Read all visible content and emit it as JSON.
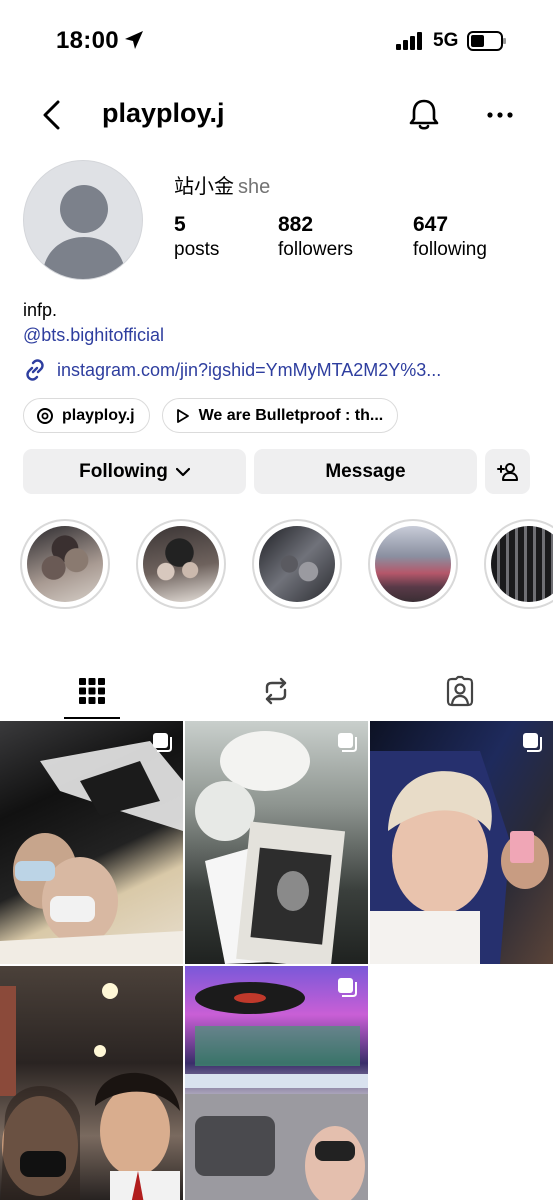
{
  "status_bar": {
    "time": "18:00",
    "network": "5G"
  },
  "header": {
    "username": "playploy.j"
  },
  "profile": {
    "display_name": "站小金",
    "pronoun": "she",
    "stats": {
      "posts": {
        "value": "5",
        "label": "posts"
      },
      "followers": {
        "value": "882",
        "label": "followers"
      },
      "following": {
        "value": "647",
        "label": "following"
      }
    },
    "bio": "infp.",
    "mention": "@bts.bighitofficial",
    "link": "instagram.com/jin?igshid=YmMyMTA2M2Y%3...",
    "chips": [
      {
        "label": "playploy.j",
        "icon": "threads-icon"
      },
      {
        "label": "We are Bulletproof : th...",
        "icon": "play-icon"
      }
    ]
  },
  "actions": {
    "following": "Following",
    "message": "Message"
  },
  "highlights": [
    {
      "icon": "highlight-photo"
    },
    {
      "icon": "highlight-photo"
    },
    {
      "icon": "highlight-photo"
    },
    {
      "icon": "highlight-photo"
    },
    {
      "icon": "highlight-photo"
    }
  ],
  "tabs": [
    {
      "name": "grid",
      "icon": "grid-icon",
      "active": true
    },
    {
      "name": "reels",
      "icon": "repost-icon",
      "active": false
    },
    {
      "name": "tagged",
      "icon": "tagged-icon",
      "active": false
    }
  ],
  "posts": [
    {
      "multi": true
    },
    {
      "multi": true
    },
    {
      "multi": true
    },
    {
      "multi": false
    },
    {
      "multi": true
    }
  ],
  "colors": {
    "link": "#2e3e9f",
    "button_bg": "#efeff0",
    "avatar_bg": "#dfe1e5",
    "muted": "#737373"
  }
}
